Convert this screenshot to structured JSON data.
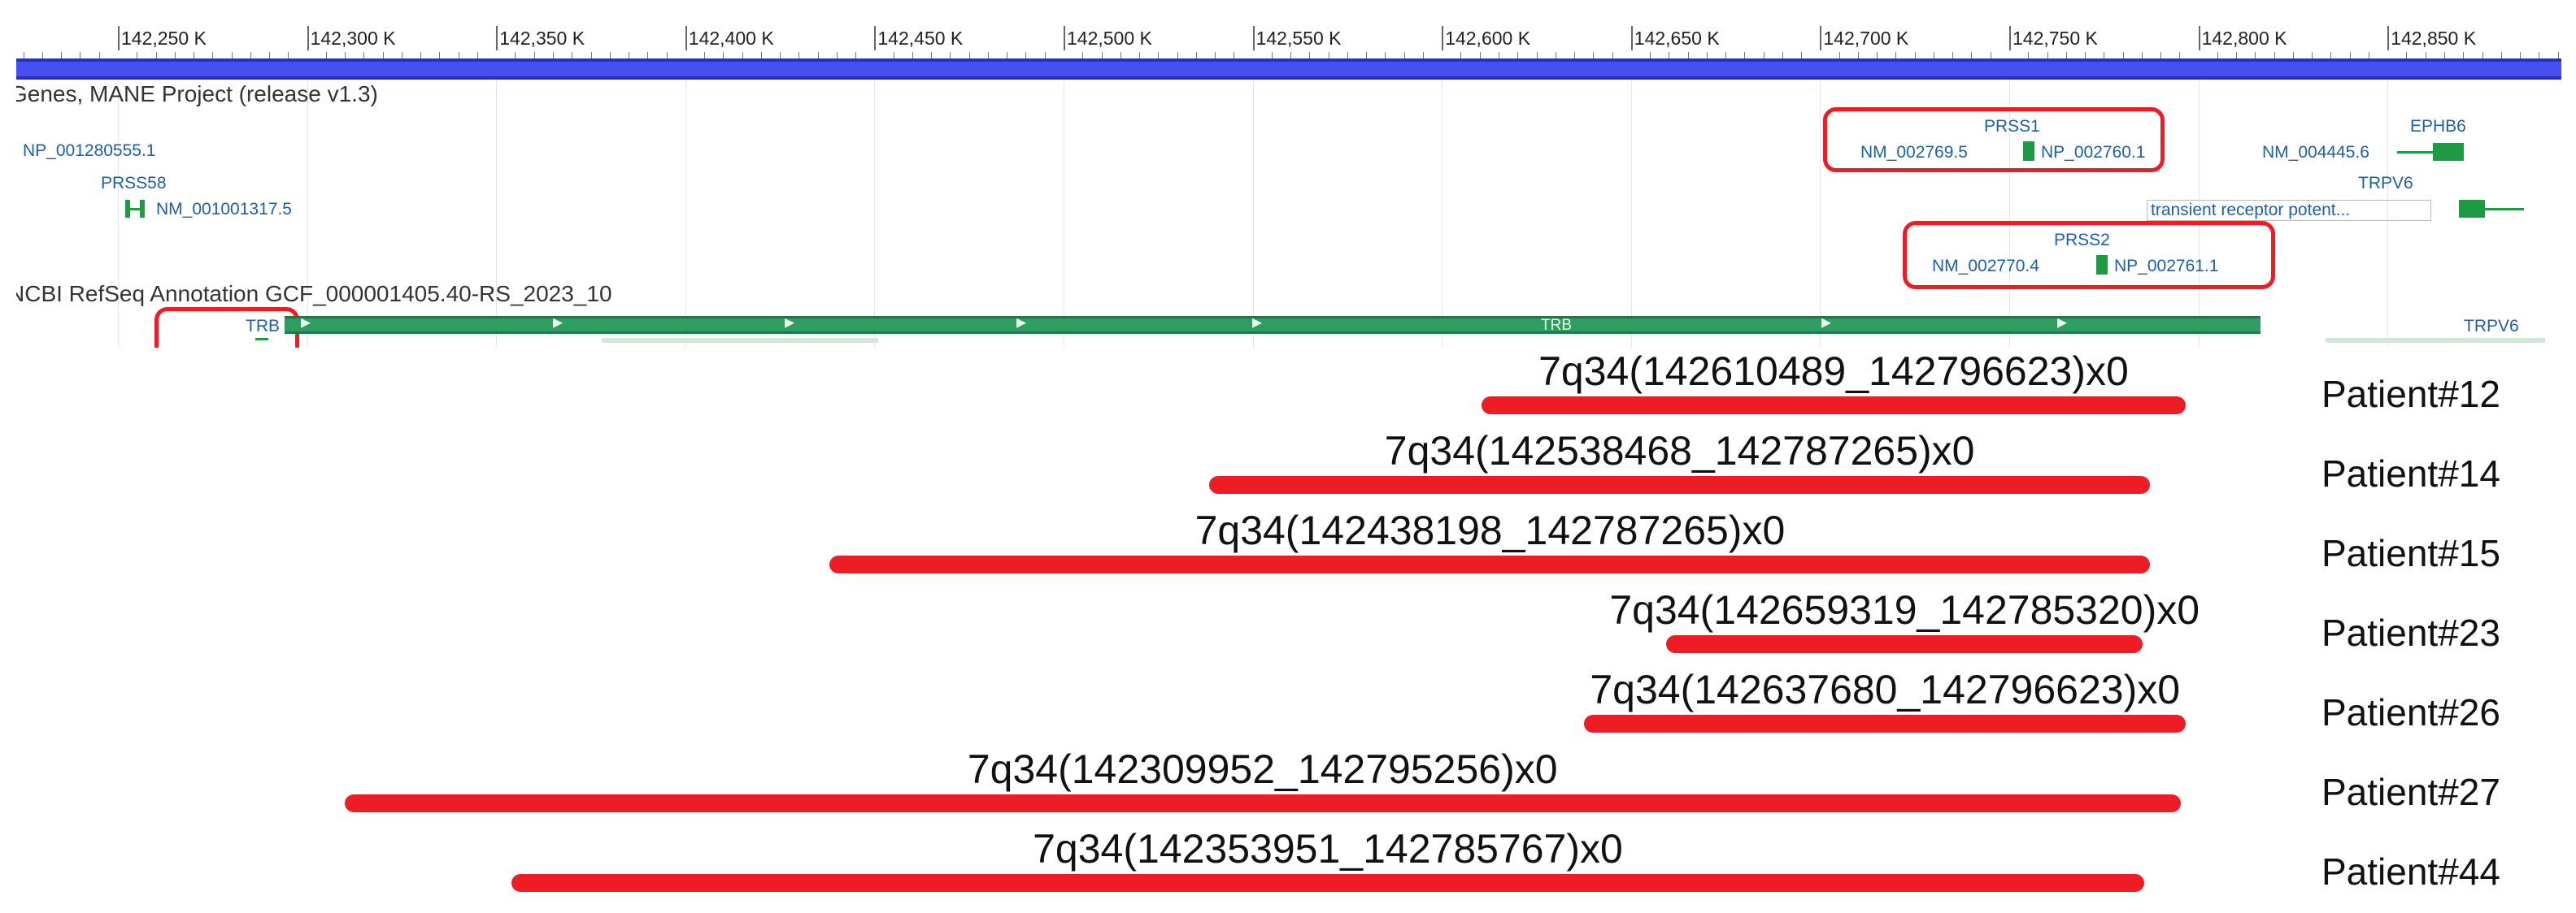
{
  "ruler": {
    "ticks": [
      "142,250 K",
      "142,300 K",
      "142,350 K",
      "142,400 K",
      "142,450 K",
      "142,500 K",
      "142,550 K",
      "142,600 K",
      "142,650 K",
      "142,700 K",
      "142,750 K",
      "142,800 K",
      "142,850 K"
    ]
  },
  "tracks": {
    "mane_title": "Genes, MANE Project (release v1.3)",
    "refseq_title": "NCBI RefSeq Annotation GCF_000001405.40-RS_2023_10"
  },
  "features": {
    "np_left": "NP_001280555.1",
    "prss58_name": "PRSS58",
    "prss58_nm": "NM_001001317.5",
    "prss1_name": "PRSS1",
    "prss1_nm": "NM_002769.5",
    "prss1_np": "NP_002760.1",
    "ephb6_name": "EPHB6",
    "ephb6_nm": "NM_004445.6",
    "trpv6_name": "TRPV6",
    "trpv6_desc": "transient receptor potent...",
    "prss2_name": "PRSS2",
    "prss2_nm": "NM_002770.4",
    "prss2_np": "NP_002761.1",
    "trb_name": "TRB",
    "trb_mid": "TRB",
    "trpv6_refseq": "TRPV6"
  },
  "colors": {
    "deletion_bar": "#ee1c25",
    "callout_outline": "#ee1c25",
    "gene_green": "#1f9b45",
    "sequence_bar": "#4450f0"
  },
  "deletions": [
    {
      "label": "7q34(142610489_142796623)x0",
      "patient": "Patient#12",
      "start": 142610489,
      "end": 142796623
    },
    {
      "label": "7q34(142538468_142787265)x0",
      "patient": "Patient#14",
      "start": 142538468,
      "end": 142787265
    },
    {
      "label": "7q34(142438198_142787265)x0",
      "patient": "Patient#15",
      "start": 142438198,
      "end": 142787265
    },
    {
      "label": "7q34(142659319_142785320)x0",
      "patient": "Patient#23",
      "start": 142659319,
      "end": 142785320
    },
    {
      "label": "7q34(142637680_142796623)x0",
      "patient": "Patient#26",
      "start": 142637680,
      "end": 142796623
    },
    {
      "label": "7q34(142309952_142795256)x0",
      "patient": "Patient#27",
      "start": 142309952,
      "end": 142795256
    },
    {
      "label": "7q34(142353951_142785767)x0",
      "patient": "Patient#44",
      "start": 142353951,
      "end": 142785767
    }
  ]
}
